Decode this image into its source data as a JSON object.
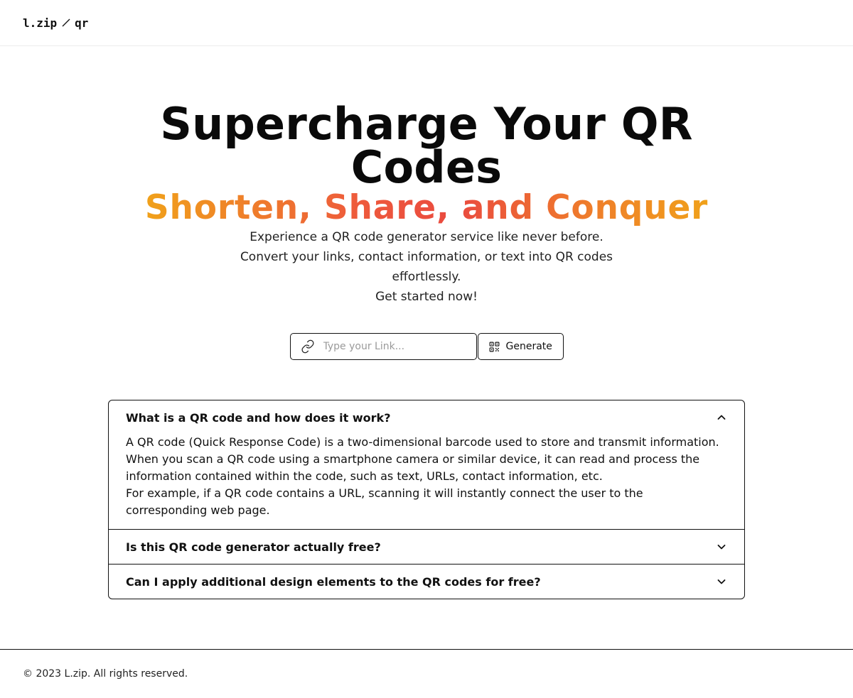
{
  "header": {
    "brand_left": "l.zip",
    "brand_right": "qr"
  },
  "hero": {
    "title": "Supercharge Your QR Codes",
    "subtitle": "Shorten, Share, and Conquer",
    "desc_line1": "Experience a QR code generator service like never before.",
    "desc_line2": "Convert your links, contact information, or text into QR codes effortlessly.",
    "desc_line3": "Get started now!"
  },
  "form": {
    "input_placeholder": "Type your Link...",
    "input_value": "",
    "generate_label": "Generate"
  },
  "faq": {
    "items": [
      {
        "question": "What is a QR code and how does it work?",
        "expanded": true,
        "answer_p1": "A QR code (Quick Response Code) is a two-dimensional barcode used to store and transmit information. When you scan a QR code using a smartphone camera or similar device, it can read and process the information contained within the code, such as text, URLs, contact information, etc.",
        "answer_p2": "For example, if a QR code contains a URL, scanning it will instantly connect the user to the corresponding web page."
      },
      {
        "question": "Is this QR code generator actually free?",
        "expanded": false
      },
      {
        "question": "Can I apply additional design elements to the QR codes for free?",
        "expanded": false
      }
    ]
  },
  "footer": {
    "copyright": "© 2023 L.zip. All rights reserved."
  },
  "icons": {
    "link": "link-icon",
    "qr": "qr-code-icon",
    "chevron_up": "chevron-up-icon",
    "chevron_down": "chevron-down-icon",
    "slash": "slash-icon"
  },
  "colors": {
    "gradient_start": "#f0a11a",
    "gradient_mid": "#ea4a3f",
    "border": "#111111"
  }
}
